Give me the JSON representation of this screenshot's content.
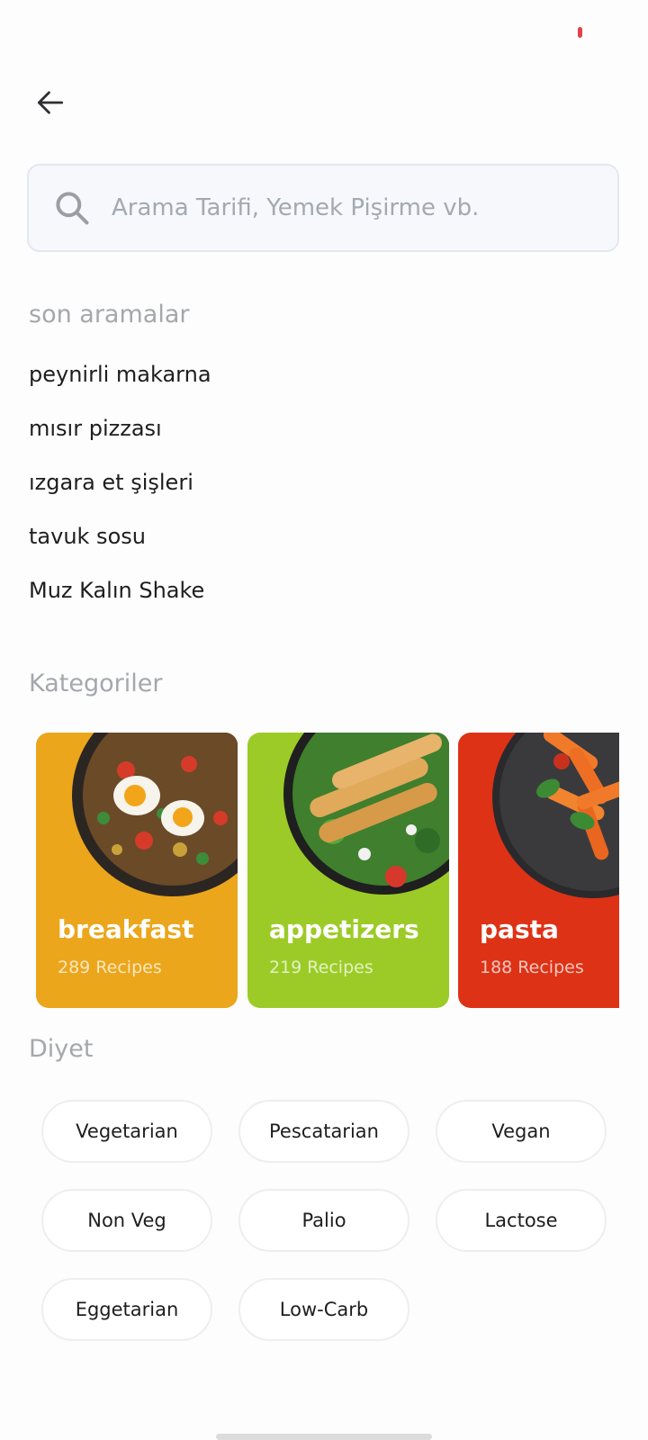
{
  "header": {
    "back_icon": "arrow-left-icon"
  },
  "search": {
    "icon": "search-icon",
    "value": "",
    "placeholder": "Arama Tarifi, Yemek Pişirme vb."
  },
  "recent": {
    "title": "son aramalar",
    "items": [
      {
        "label": "peynirli makarna"
      },
      {
        "label": "mısır pizzası"
      },
      {
        "label": "ızgara et şişleri"
      },
      {
        "label": "tavuk sosu"
      },
      {
        "label": "Muz Kalın Shake"
      }
    ]
  },
  "categories": {
    "title": "Kategoriler",
    "items": [
      {
        "name": "breakfast",
        "count": "289 Recipes",
        "color": "#eba61b"
      },
      {
        "name": "appetizers",
        "count": "219 Recipes",
        "color": "#9ccb27"
      },
      {
        "name": "pasta",
        "count": "188 Recipes",
        "color": "#dd3216"
      }
    ]
  },
  "diet": {
    "title": "Diyet",
    "items": [
      {
        "label": "Vegetarian"
      },
      {
        "label": "Pescatarian"
      },
      {
        "label": "Vegan"
      },
      {
        "label": "Non Veg"
      },
      {
        "label": "Palio"
      },
      {
        "label": "Lactose"
      },
      {
        "label": "Eggetarian"
      },
      {
        "label": "Low-Carb"
      }
    ]
  },
  "colors": {
    "status_indicator": "#e0434a",
    "muted_text": "#a4a7ac",
    "search_background": "#f6f8fb"
  }
}
